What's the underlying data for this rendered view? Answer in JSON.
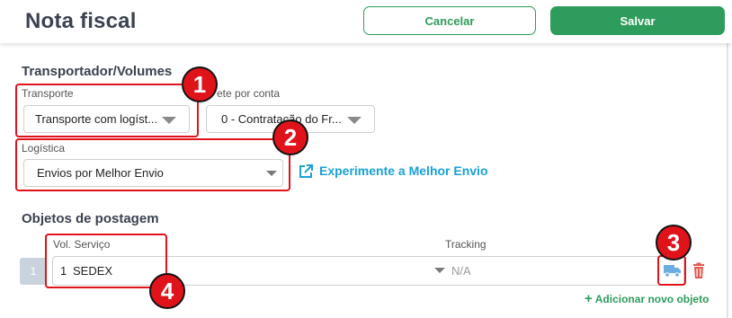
{
  "header": {
    "title": "Nota fiscal",
    "cancel_label": "Cancelar",
    "save_label": "Salvar"
  },
  "transport_section": {
    "title": "Transportador/Volumes",
    "transporte_label": "Transporte",
    "transporte_value": "Transporte com logíst...",
    "frete_label": "ete por conta",
    "frete_value": "0 - Contratação do Fr...",
    "logistica_label": "Logística",
    "logistica_value": "Envios por Melhor Envio",
    "experiment_link": "Experimente a Melhor Envio"
  },
  "objects_section": {
    "title": "Objetos de postagem",
    "col_service": "Vol. Serviço",
    "col_tracking": "Tracking",
    "rows": [
      {
        "index": "1",
        "vol": "1",
        "service": "SEDEX",
        "tracking": "N/A"
      }
    ],
    "add_label": "Adicionar novo objeto"
  },
  "annotations": [
    "1",
    "2",
    "3",
    "4"
  ],
  "colors": {
    "brand_green": "#2e9c5b",
    "link_blue": "#1aa1d6",
    "annotation_red": "#e0131b",
    "delete_red": "#e05a4f"
  },
  "icons": [
    "external-link-icon",
    "truck-icon",
    "trash-icon",
    "plus-icon",
    "chevron-down-icon"
  ]
}
